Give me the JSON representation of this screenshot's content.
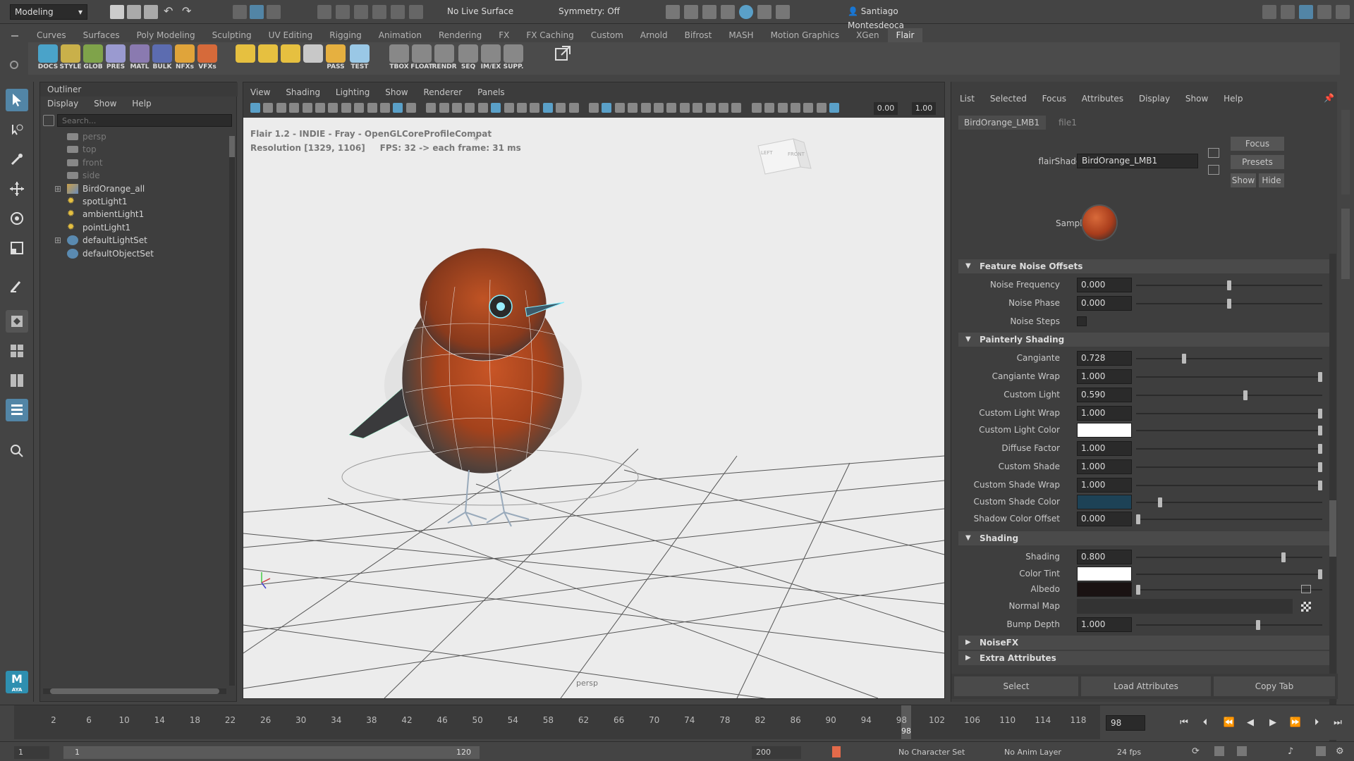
{
  "status_line": {
    "workspace": "Modeling",
    "live_surface": "No Live Surface",
    "symmetry": "Symmetry: Off",
    "user": "Santiago Montesdeoca"
  },
  "shelf_tabs": [
    "Curves",
    "Surfaces",
    "Poly Modeling",
    "Sculpting",
    "UV Editing",
    "Rigging",
    "Animation",
    "Rendering",
    "FX",
    "FX Caching",
    "Custom",
    "Arnold",
    "Bifrost",
    "MASH",
    "Motion Graphics",
    "XGen",
    "Flair"
  ],
  "shelf_active": "Flair",
  "shelf_icons": [
    "DOCS",
    "STYLE",
    "GLOB",
    "PRES",
    "MATL",
    "BULK",
    "NFXs",
    "VFXs",
    "",
    "",
    "",
    "",
    "PASS",
    "TEST",
    "TBOX",
    "FLOAT",
    "RENDR",
    "SEQ",
    "IM/EX",
    "SUPP."
  ],
  "outliner": {
    "title": "Outliner",
    "menu": [
      "Display",
      "Show",
      "Help"
    ],
    "search_placeholder": "Search...",
    "items": [
      {
        "label": "persp",
        "dim": true
      },
      {
        "label": "top",
        "dim": true
      },
      {
        "label": "front",
        "dim": true
      },
      {
        "label": "side",
        "dim": true
      },
      {
        "label": "BirdOrange_all",
        "dim": false
      },
      {
        "label": "spotLight1",
        "dim": false
      },
      {
        "label": "ambientLight1",
        "dim": false
      },
      {
        "label": "pointLight1",
        "dim": false
      },
      {
        "label": "defaultLightSet",
        "dim": false
      },
      {
        "label": "defaultObjectSet",
        "dim": false
      }
    ]
  },
  "viewport": {
    "menu": [
      "View",
      "Shading",
      "Lighting",
      "Show",
      "Renderer",
      "Panels"
    ],
    "field1": "0.00",
    "field2": "1.00",
    "hud_line1": "Flair 1.2 - INDIE - Fray - OpenGLCoreProfileCompat",
    "hud_line2": "Resolution [1329, 1106]     FPS: 32 -> each frame: 31 ms",
    "camera": "persp",
    "cube_left": "LEFT",
    "cube_front": "FRONT"
  },
  "attr_editor": {
    "menu": [
      "List",
      "Selected",
      "Focus",
      "Attributes",
      "Display",
      "Show",
      "Help"
    ],
    "tabs": [
      "BirdOrange_LMB1",
      "file1"
    ],
    "shader_label": "flairShader:",
    "shader_value": "BirdOrange_LMB1",
    "focus_btn": "Focus",
    "presets_btn": "Presets",
    "show_btn": "Show",
    "hide_btn": "Hide",
    "sample_label": "Sample",
    "sections": {
      "noise_offsets": "Feature Noise Offsets",
      "painterly": "Painterly Shading",
      "shading": "Shading",
      "noisefx": "NoiseFX",
      "extra": "Extra Attributes"
    },
    "noise_offsets": [
      {
        "label": "Noise Frequency",
        "value": "0.000",
        "slider": 0.5
      },
      {
        "label": "Noise Phase",
        "value": "0.000",
        "slider": 0.5
      },
      {
        "label": "Noise Steps",
        "checkbox": true
      }
    ],
    "painterly": [
      {
        "label": "Cangiante",
        "value": "0.728",
        "slider": 0.25
      },
      {
        "label": "Cangiante Wrap",
        "value": "1.000",
        "slider": 1.0
      },
      {
        "label": "Custom Light",
        "value": "0.590",
        "slider": 0.59
      },
      {
        "label": "Custom Light Wrap",
        "value": "1.000",
        "slider": 1.0
      },
      {
        "label": "Custom Light Color",
        "color": "#ffffff",
        "slider": 1.0
      },
      {
        "label": "Diffuse Factor",
        "value": "1.000",
        "slider": 1.0
      },
      {
        "label": "Custom Shade",
        "value": "1.000",
        "slider": 1.0
      },
      {
        "label": "Custom Shade Wrap",
        "value": "1.000",
        "slider": 1.0
      },
      {
        "label": "Custom Shade Color",
        "color": "#1d4256",
        "slider": 0.12
      },
      {
        "label": "Shadow Color Offset",
        "value": "0.000",
        "slider": 0.0
      }
    ],
    "shading": [
      {
        "label": "Shading",
        "value": "0.800",
        "slider": 0.8
      },
      {
        "label": "Color Tint",
        "color": "#ffffff",
        "slider": 1.0
      },
      {
        "label": "Albedo",
        "color": "#1a1212",
        "slider": 0.0
      },
      {
        "label": "Normal Map",
        "map": true
      },
      {
        "label": "Bump Depth",
        "value": "1.000",
        "slider": 0.66
      }
    ],
    "bottom_buttons": [
      "Select",
      "Load Attributes",
      "Copy Tab"
    ]
  },
  "time_slider": {
    "ticks": [
      "2",
      "6",
      "10",
      "14",
      "18",
      "22",
      "26",
      "30",
      "34",
      "38",
      "42",
      "46",
      "50",
      "54",
      "58",
      "62",
      "66",
      "70",
      "74",
      "78",
      "82",
      "86",
      "90",
      "94",
      "98",
      "102",
      "106",
      "110",
      "114",
      "118"
    ],
    "current_frame": "98",
    "current_field": "98"
  },
  "range_bar": {
    "start": "1",
    "range_start": "1",
    "range_end": "120",
    "end": "200",
    "character_set": "No Character Set",
    "anim_layer": "No Anim Layer",
    "fps": "24 fps"
  },
  "colors": {
    "accent": "#5285a6",
    "bird_orange": "#b8471f",
    "bg_panel": "#444444"
  }
}
